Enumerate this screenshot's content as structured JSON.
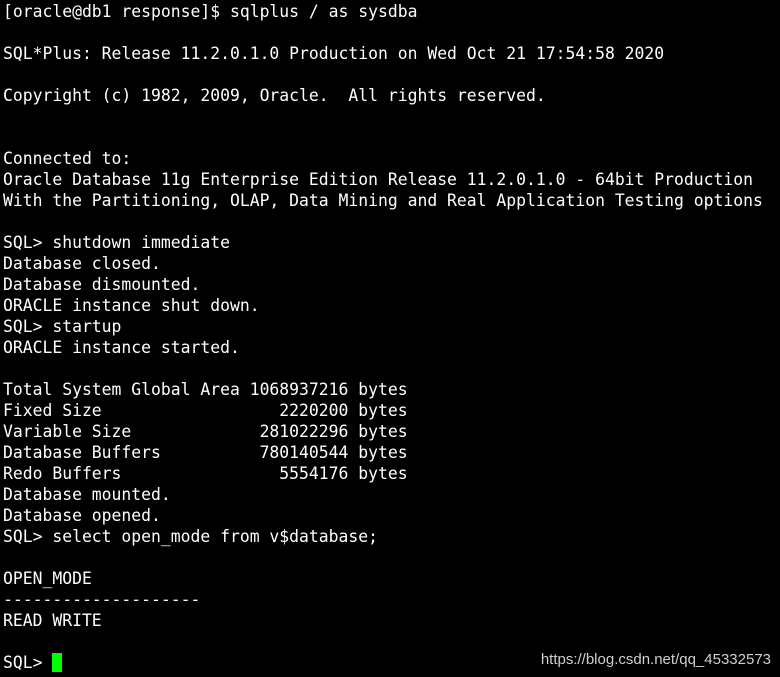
{
  "terminal": {
    "lines": [
      "[oracle@db1 response]$ sqlplus / as sysdba",
      "",
      "SQL*Plus: Release 11.2.0.1.0 Production on Wed Oct 21 17:54:58 2020",
      "",
      "Copyright (c) 1982, 2009, Oracle.  All rights reserved.",
      "",
      "",
      "Connected to:",
      "Oracle Database 11g Enterprise Edition Release 11.2.0.1.0 - 64bit Production",
      "With the Partitioning, OLAP, Data Mining and Real Application Testing options",
      "",
      "SQL> shutdown immediate",
      "Database closed.",
      "Database dismounted.",
      "ORACLE instance shut down.",
      "SQL> startup",
      "ORACLE instance started.",
      "",
      "Total System Global Area 1068937216 bytes",
      "Fixed Size                  2220200 bytes",
      "Variable Size             281022296 bytes",
      "Database Buffers          780140544 bytes",
      "Redo Buffers                5554176 bytes",
      "Database mounted.",
      "Database opened.",
      "SQL> select open_mode from v$database;",
      "",
      "OPEN_MODE",
      "--------------------",
      "READ WRITE",
      "",
      "SQL> "
    ],
    "cursor_color": "#00ff00",
    "background_color": "#000000",
    "text_color": "#ffffff"
  },
  "watermark": {
    "text": "https://blog.csdn.net/qq_45332573"
  }
}
